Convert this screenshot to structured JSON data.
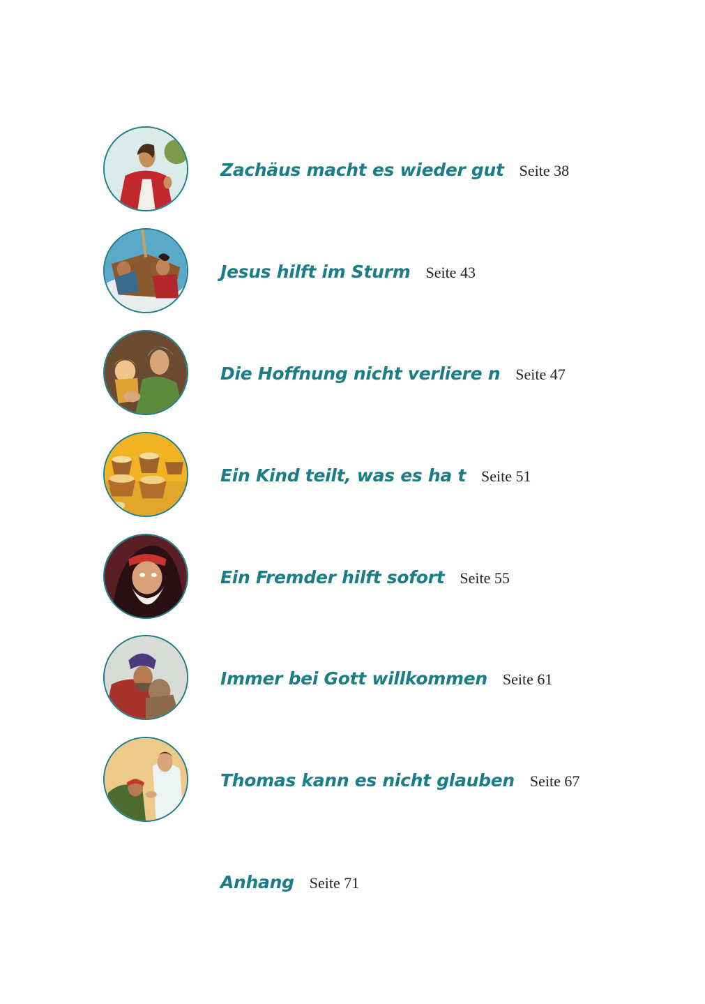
{
  "entries": [
    {
      "title": "Zachäus macht es wieder gut",
      "page": "Seite 38",
      "image": "illustration-zacchaeus-looking-up"
    },
    {
      "title": "Jesus hilft im Sturm",
      "page": "Seite 43",
      "image": "illustration-men-in-storm-boat"
    },
    {
      "title": "Die Hoffnung nicht verliere n",
      "page": "Seite 47",
      "image": "illustration-father-holding-child"
    },
    {
      "title": "Ein Kind teilt, was es ha t",
      "page": "Seite 51",
      "image": "illustration-bread-baskets"
    },
    {
      "title": "Ein Fremder hilft sofort",
      "page": "Seite 55",
      "image": "illustration-old-bearded-man"
    },
    {
      "title": "Immer bei Gott willkommen",
      "page": "Seite 61",
      "image": "illustration-embrace"
    },
    {
      "title": "Thomas kann es nicht glauben",
      "page": "Seite 67",
      "image": "illustration-thomas-kneeling"
    }
  ],
  "appendix": {
    "title": "Anhang",
    "page": "Seite 71"
  },
  "colors": {
    "accent": "#1b7d86",
    "text": "#222222"
  }
}
